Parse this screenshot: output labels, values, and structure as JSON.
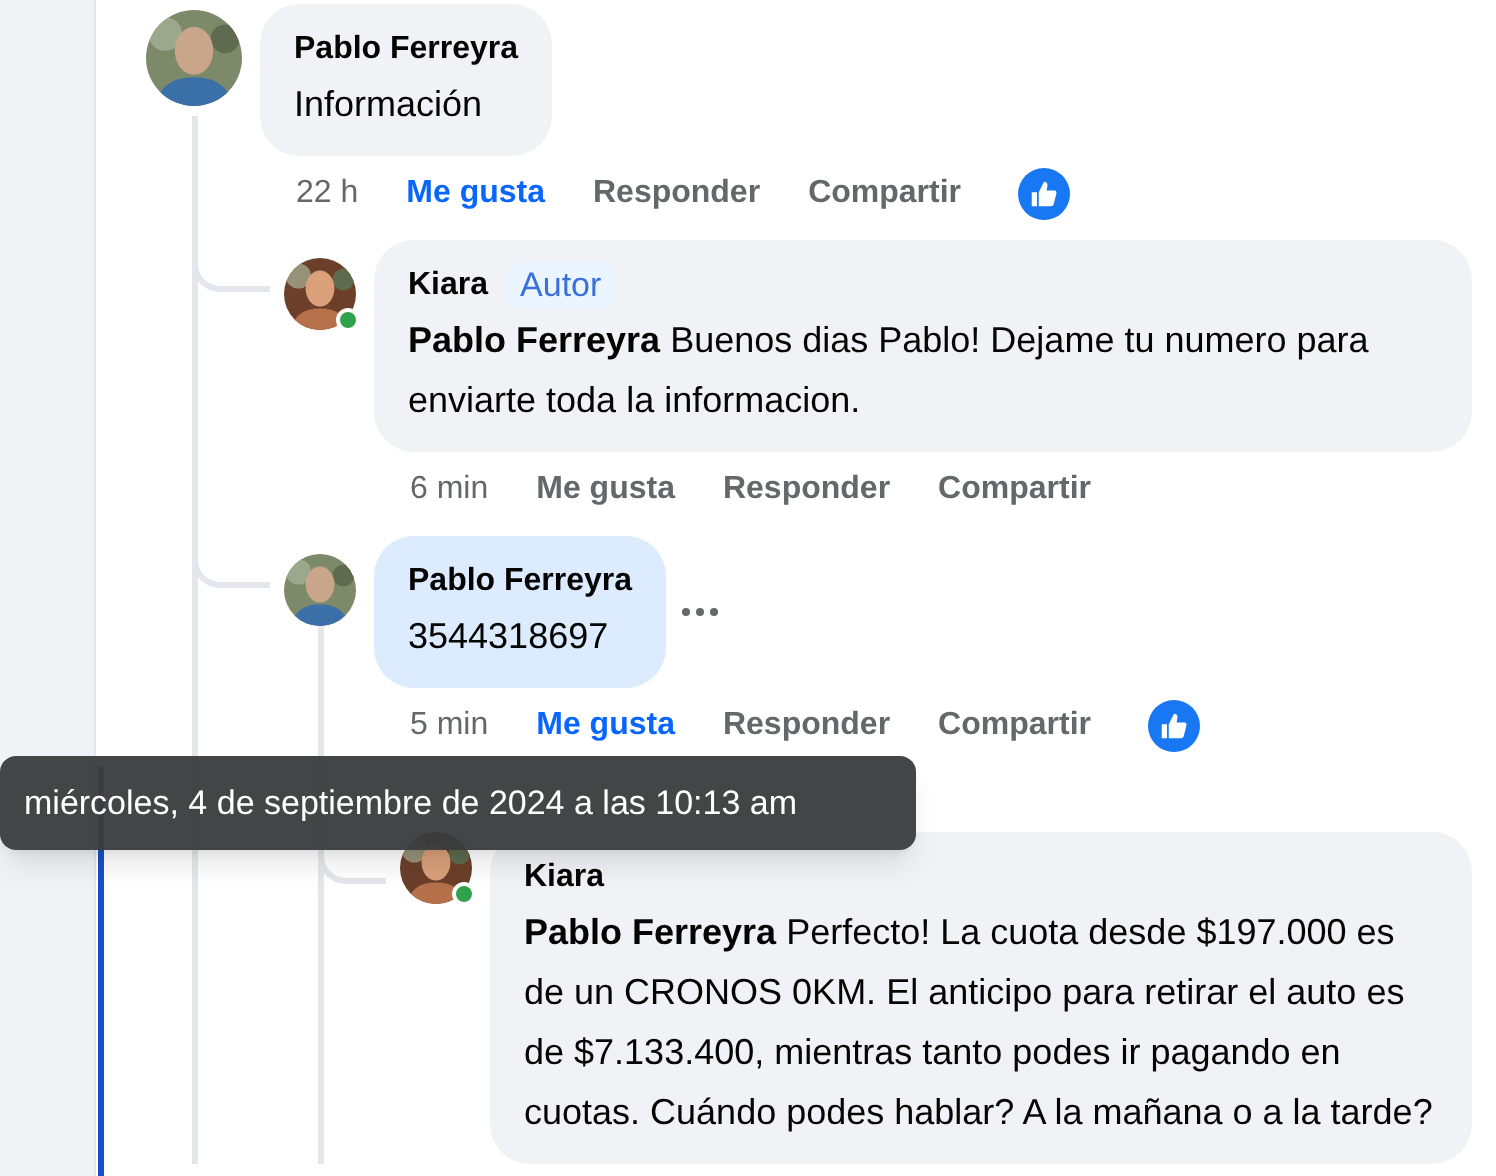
{
  "comments": [
    {
      "author": "Pablo Ferreyra",
      "online": false,
      "highlighted": false,
      "menu": false,
      "text": "Información",
      "time": "22 h",
      "actions": [
        {
          "label": "Me gusta",
          "selected": true
        },
        {
          "label": "Responder",
          "selected": false
        },
        {
          "label": "Compartir",
          "selected": false
        }
      ],
      "reacted": true,
      "children": [
        {
          "author": "Kiara",
          "badge": "Autor",
          "online": true,
          "highlighted": false,
          "menu": false,
          "text": "**Pablo Ferreyra** Buenos dias Pablo! Dejame tu numero para enviarte toda la informacion.",
          "time": "6 min",
          "actions": [
            {
              "label": "Me gusta",
              "selected": false
            },
            {
              "label": "Responder",
              "selected": false
            },
            {
              "label": "Compartir",
              "selected": false
            }
          ],
          "reacted": false
        },
        {
          "author": "Pablo Ferreyra",
          "online": false,
          "highlighted": true,
          "menu": true,
          "text": "3544318697",
          "time": "5 min",
          "actions": [
            {
              "label": "Me gusta",
              "selected": true
            },
            {
              "label": "Responder",
              "selected": false
            },
            {
              "label": "Compartir",
              "selected": false
            }
          ],
          "reacted": true,
          "children": [
            {
              "author": "Kiara",
              "online": true,
              "highlighted": false,
              "menu": false,
              "text": "**Pablo Ferreyra** Perfecto! La cuota desde $197.000 es de un CRONOS 0KM. El anticipo para retirar el auto es de $7.133.400, mientras tanto podes ir pagando en cuotas. Cuándo podes hablar? A la mañana o a la tarde?"
            }
          ]
        }
      ]
    }
  ],
  "tooltip": {
    "text": "miércoles, 4 de septiembre de 2024 a las 10:13 am"
  }
}
